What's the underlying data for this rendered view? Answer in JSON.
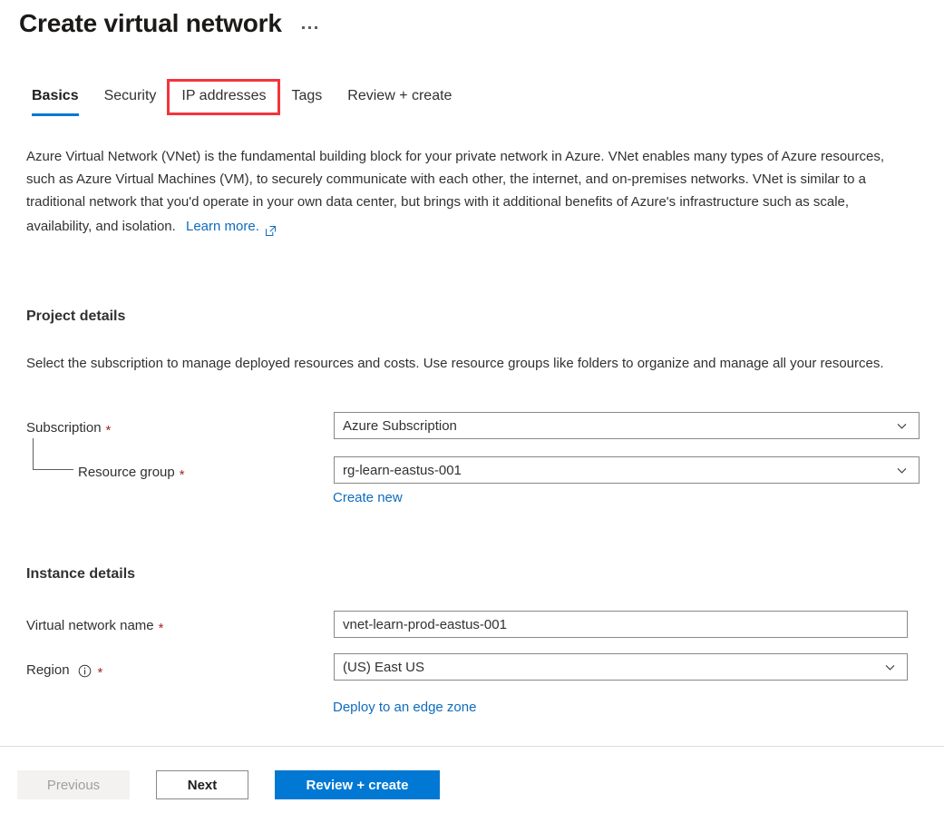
{
  "header": {
    "title": "Create virtual network",
    "more_menu_label": "..."
  },
  "tabs": [
    {
      "label": "Basics",
      "active": true
    },
    {
      "label": "Security",
      "active": false
    },
    {
      "label": "IP addresses",
      "active": false,
      "highlighted": true
    },
    {
      "label": "Tags",
      "active": false
    },
    {
      "label": "Review + create",
      "active": false
    }
  ],
  "intro": {
    "paragraph": "Azure Virtual Network (VNet) is the fundamental building block for your private network in Azure. VNet enables many types of Azure resources, such as Azure Virtual Machines (VM), to securely communicate with each other, the internet, and on-premises networks. VNet is similar to a traditional network that you'd operate in your own data center, but brings with it additional benefits of Azure's infrastructure such as scale, availability, and isolation.",
    "learn_more": "Learn more."
  },
  "project_details": {
    "heading": "Project details",
    "description": "Select the subscription to manage deployed resources and costs. Use resource groups like folders to organize and manage all your resources.",
    "subscription": {
      "label": "Subscription",
      "required": "*",
      "value": "Azure Subscription"
    },
    "resource_group": {
      "label": "Resource group",
      "required": "*",
      "value": "rg-learn-eastus-001",
      "create_new": "Create new"
    }
  },
  "instance_details": {
    "heading": "Instance details",
    "vnet_name": {
      "label": "Virtual network name",
      "required": "*",
      "value": "vnet-learn-prod-eastus-001"
    },
    "region": {
      "label": "Region",
      "required": "*",
      "value": "(US) East US",
      "edge_zone_link": "Deploy to an edge zone"
    }
  },
  "footer": {
    "previous": "Previous",
    "next": "Next",
    "review_create": "Review + create"
  },
  "colors": {
    "accent": "#0078d4",
    "link": "#0f6cbd",
    "required": "#a4262c",
    "highlight": "#f4333d",
    "text": "#323130",
    "border": "#8a8886"
  }
}
